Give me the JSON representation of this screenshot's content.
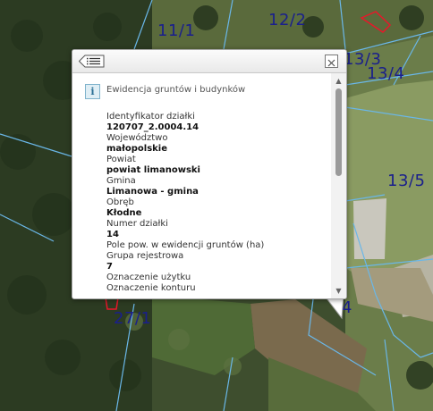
{
  "map": {
    "parcel_labels": [
      "11/1",
      "12/2",
      "13/3",
      "13/4",
      "13/5",
      "27/1",
      "4"
    ]
  },
  "popup": {
    "layer_title": "Ewidencja gruntów i budynków",
    "fields": [
      {
        "label": "Identyfikator działki",
        "value": "120707_2.0004.14"
      },
      {
        "label": "Województwo",
        "value": "małopolskie"
      },
      {
        "label": "Powiat",
        "value": "powiat limanowski"
      },
      {
        "label": "Gmina",
        "value": "Limanowa - gmina"
      },
      {
        "label": "Obręb",
        "value": "Kłodne"
      },
      {
        "label": "Numer działki",
        "value": "14"
      },
      {
        "label": "Pole pow. w ewidencji gruntów (ha)",
        "value": ""
      },
      {
        "label": "Grupa rejestrowa",
        "value": "7"
      },
      {
        "label": "Oznaczenie użytku",
        "value": ""
      },
      {
        "label": "Oznaczenie konturu",
        "value": ""
      }
    ]
  },
  "colors": {
    "parcel_line": "#6ab7e8",
    "parcel_label": "#1a1f8c",
    "highlight": "#e8172a"
  }
}
